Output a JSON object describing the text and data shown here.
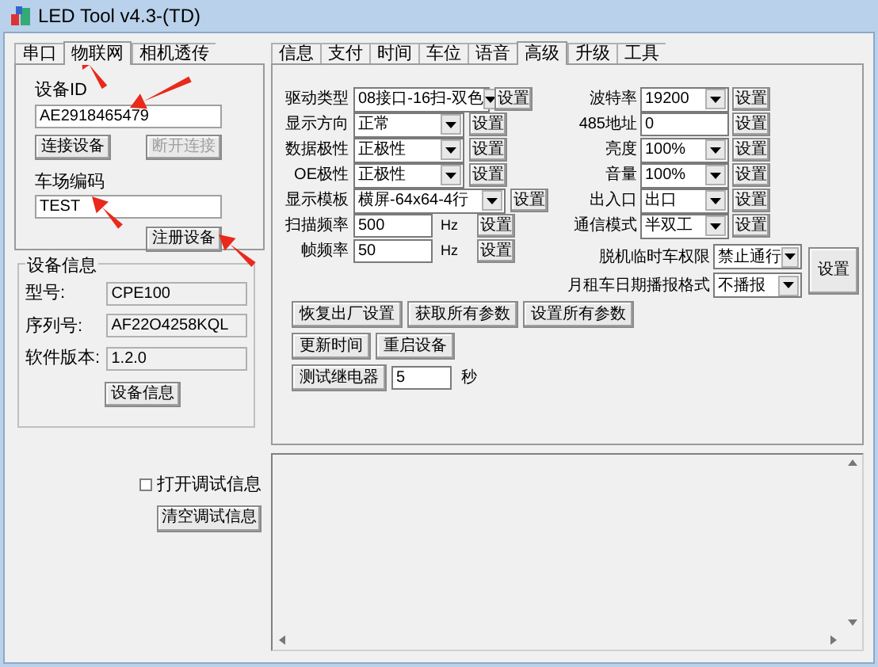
{
  "window": {
    "title": "LED Tool v4.3-(TD)"
  },
  "left_tabs": [
    {
      "label": "串口",
      "selected": false
    },
    {
      "label": "物联网",
      "selected": true
    },
    {
      "label": "相机透传",
      "selected": false
    }
  ],
  "iot": {
    "device_id_label": "设备ID",
    "device_id": "AE2918465479",
    "connect_buttons": [
      {
        "label": "连接设备",
        "disabled": false
      },
      {
        "label": "断开连接",
        "disabled": true
      }
    ],
    "parking_label": "车场编码",
    "parking_code": "TEST",
    "register_button": "注册设备"
  },
  "device_info": {
    "title": "设备信息",
    "fields": [
      {
        "label": "型号:",
        "value": "CPE100"
      },
      {
        "label": "序列号:",
        "value": "AF22O4258KQL"
      },
      {
        "label": "软件版本:",
        "value": "1.2.0"
      }
    ],
    "button": "设备信息"
  },
  "debug": {
    "checkbox": {
      "label": "打开调试信息",
      "checked": false
    },
    "clear_button": "清空调试信息"
  },
  "right_tabs": [
    {
      "label": "信息",
      "selected": false
    },
    {
      "label": "支付",
      "selected": false
    },
    {
      "label": "时间",
      "selected": false
    },
    {
      "label": "车位",
      "selected": false
    },
    {
      "label": "语音",
      "selected": false
    },
    {
      "label": "高级",
      "selected": true
    },
    {
      "label": "升级",
      "selected": false
    },
    {
      "label": "工具",
      "selected": false
    }
  ],
  "advanced": {
    "left_rows": [
      {
        "kind": "select",
        "label": "驱动类型",
        "value": "08接口-16扫-双色",
        "button": "设置"
      },
      {
        "kind": "select",
        "label": "显示方向",
        "value": "正常",
        "button": "设置"
      },
      {
        "kind": "select",
        "label": "数据极性",
        "value": "正极性",
        "button": "设置"
      },
      {
        "kind": "select",
        "label": "OE极性",
        "value": "正极性",
        "button": "设置"
      },
      {
        "kind": "select",
        "label": "显示模板",
        "value": "横屏-64x64-4行",
        "button": "设置"
      },
      {
        "kind": "input",
        "label": "扫描频率",
        "value": "500",
        "unit": "Hz",
        "button": "设置"
      },
      {
        "kind": "input",
        "label": "帧频率",
        "value": "50",
        "unit": "Hz",
        "button": "设置"
      }
    ],
    "right_rows": [
      {
        "kind": "select",
        "label": "波特率",
        "value": "19200",
        "button": "设置"
      },
      {
        "kind": "input",
        "label": "485地址",
        "value": "0",
        "button": "设置"
      },
      {
        "kind": "select",
        "label": "亮度",
        "value": "100%",
        "button": "设置"
      },
      {
        "kind": "select",
        "label": "音量",
        "value": "100%",
        "button": "设置"
      },
      {
        "kind": "select",
        "label": "出入口",
        "value": "出口",
        "button": "设置"
      },
      {
        "kind": "select",
        "label": "通信模式",
        "value": "半双工",
        "button": "设置"
      }
    ],
    "wide_rows": [
      {
        "label": "脱机临时车权限",
        "value": "禁止通行"
      },
      {
        "label": "月租车日期播报格式",
        "value": "不播报"
      }
    ],
    "wide_button": "设置",
    "actions": [
      [
        "恢复出厂设置",
        "获取所有参数",
        "设置所有参数"
      ],
      [
        "更新时间",
        "重启设备"
      ],
      [
        "测试继电器"
      ]
    ],
    "relay_seconds": "5",
    "seconds_unit": "秒"
  }
}
